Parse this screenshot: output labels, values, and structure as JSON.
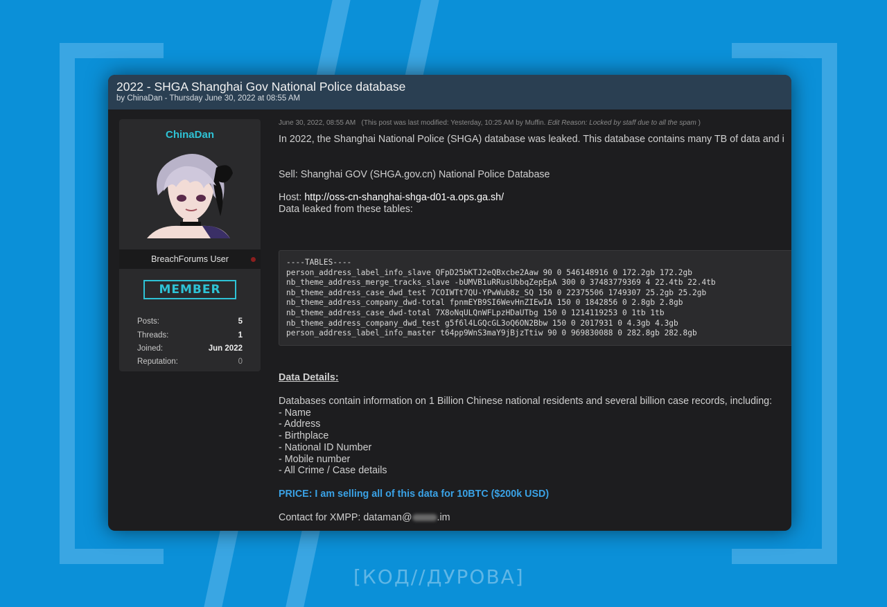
{
  "post": {
    "title": "2022 - SHGA Shanghai Gov National Police database",
    "byline": "by ChinaDan - Thursday June 30, 2022 at 08:55 AM",
    "meta_date": "June 30, 2022, 08:55 AM",
    "meta_modified": "(This post was last modified: Yesterday, 10:25 AM by Muffin.",
    "meta_reason": "Edit Reason: Locked by staff due to all the spam",
    "meta_close": ")",
    "intro": "In 2022, the Shanghai National Police (SHGA) database was leaked. This database contains many TB of data and i",
    "sell": "Sell: Shanghai GOV (SHGA.gov.cn) National Police Database",
    "host_label": "Host:",
    "host_url": "http://oss-cn-shanghai-shga-d01-a.ops.ga.sh/",
    "tables_intro": "Data leaked from these tables:",
    "code_lines": [
      "----TABLES----",
      "person_address_label_info_slave QFpD25bKTJ2eQBxcbe2Aaw 90 0 546148916 0 172.2gb 172.2gb",
      "nb_theme_address_merge_tracks_slave -bUMVB1uRRusUbbqZepEpA 300 0 37483779369 4 22.4tb 22.4tb",
      "nb_theme_address_case_dwd_test 7COIWTt7QU-YPwWub8z_SQ 150 0 22375506 1749307 25.2gb 25.2gb",
      "nb_theme_address_company_dwd-total fpnmEYB9SI6WevHnZIEwIA 150 0 1842856 0 2.8gb 2.8gb",
      "nb_theme_address_case_dwd-total 7X8oNqULQnWFLpzHDaUTbg 150 0 1214119253 0 1tb 1tb",
      "nb_theme_address_company_dwd_test g5f6l4LGQcGL3oQ6ON2Bbw 150 0 2017931 0 4.3gb 4.3gb",
      "person_address_label_info_master t64pp9WnS3maY9jBjzTtiw 90 0 969830088 0 282.8gb 282.8gb"
    ],
    "details_heading": "Data Details:",
    "details_intro": "Databases contain information on 1 Billion Chinese national residents and several billion case records, including:",
    "details_items": [
      "- Name",
      "- Address",
      "- Birthplace",
      "- National ID Number",
      "- Mobile number",
      "- All Crime / Case details"
    ],
    "price": "PRICE: I am selling all of this data for 10BTC ($200k USD)",
    "contact_prefix": "Contact for XMPP: dataman@",
    "contact_suffix": ".im"
  },
  "author": {
    "username": "ChinaDan",
    "role": "BreachForums User",
    "rank_badge": "MEMBER",
    "stats": [
      {
        "label": "Posts:",
        "value": "5"
      },
      {
        "label": "Threads:",
        "value": "1"
      },
      {
        "label": "Joined:",
        "value": "Jun 2022"
      },
      {
        "label": "Reputation:",
        "value": "0"
      }
    ]
  },
  "brand": {
    "text": "[КОД//ДУРОВА]"
  },
  "colors": {
    "accent": "#2ec3d6",
    "price": "#3aa2e6",
    "background": "#0b90d8",
    "titlebar": "#2a3f52"
  }
}
